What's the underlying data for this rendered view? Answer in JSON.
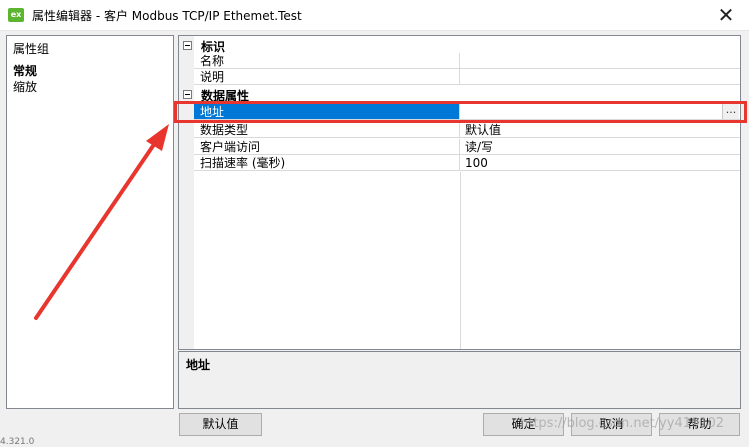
{
  "window": {
    "icon_text": "ex",
    "title": "属性编辑器 - 客户  Modbus TCP/IP Ethemet.Test",
    "close_glyph": "✕"
  },
  "property_groups": {
    "header": "属性组",
    "items": [
      {
        "label": "常规",
        "selected": true
      },
      {
        "label": "缩放",
        "selected": false
      }
    ]
  },
  "property_grid": {
    "categories": [
      {
        "label": "标识",
        "properties": [
          {
            "name": "名称",
            "value": ""
          },
          {
            "name": "说明",
            "value": ""
          }
        ]
      },
      {
        "label": "数据属性",
        "properties": [
          {
            "name": "地址",
            "value": "",
            "selected": true,
            "button": "..."
          },
          {
            "name": "数据类型",
            "value": "默认值"
          },
          {
            "name": "客户端访问",
            "value": "读/写"
          },
          {
            "name": "扫描速率 (毫秒)",
            "value": "100"
          }
        ]
      }
    ]
  },
  "description": {
    "title": "地址"
  },
  "buttons": {
    "default": "默认值",
    "ok": "确定",
    "cancel": "取消",
    "help": "帮助"
  },
  "watermark": "https://blog.csdn.net/yy410102",
  "background_text": "4.321.0",
  "colors": {
    "selection": "#0078d7",
    "annotation": "#e8352e",
    "app_icon": "#5cb531"
  }
}
